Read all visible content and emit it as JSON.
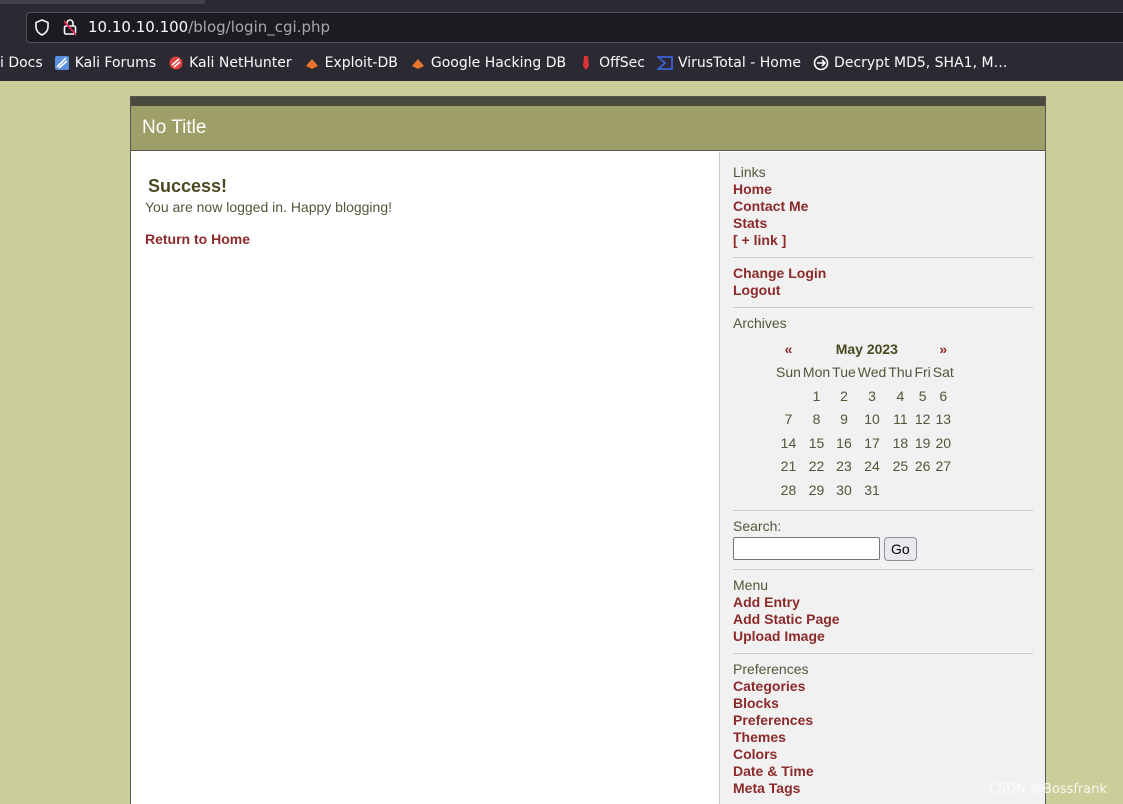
{
  "browser": {
    "url_host": "10.10.10.100",
    "url_path": "/blog/login_cgi.php",
    "bookmarks": [
      {
        "label": "i Docs",
        "icon": "none"
      },
      {
        "label": "Kali Forums",
        "icon": "kali-dragon-icon",
        "color": "#5a8fe0"
      },
      {
        "label": "Kali NetHunter",
        "icon": "nethunter-icon",
        "color": "#e0413f"
      },
      {
        "label": "Exploit-DB",
        "icon": "exploit-db-icon",
        "color": "#e8742a"
      },
      {
        "label": "Google Hacking DB",
        "icon": "ghdb-icon",
        "color": "#e8742a"
      },
      {
        "label": "OffSec",
        "icon": "offsec-icon",
        "color": "#d8323a"
      },
      {
        "label": "VirusTotal - Home",
        "icon": "virustotal-icon",
        "color": "#3b61d6"
      },
      {
        "label": "Decrypt MD5, SHA1, M…",
        "icon": "decrypt-icon",
        "color": "#ffffff"
      }
    ]
  },
  "site": {
    "title": "No Title"
  },
  "main": {
    "heading": "Success!",
    "message": "You are now logged in. Happy blogging!",
    "return_link": "Return to Home"
  },
  "sidebar": {
    "links_heading": "Links",
    "links": [
      "Home",
      "Contact Me",
      "Stats",
      "[ + link ]"
    ],
    "account_links": [
      "Change Login",
      "Logout"
    ],
    "archives_heading": "Archives",
    "calendar": {
      "prev": "«",
      "month": "May 2023",
      "next": "»",
      "weekdays": [
        "Sun",
        "Mon",
        "Tue",
        "Wed",
        "Thu",
        "Fri",
        "Sat"
      ],
      "weeks": [
        [
          "",
          "1",
          "2",
          "3",
          "4",
          "5",
          "6"
        ],
        [
          "7",
          "8",
          "9",
          "10",
          "11",
          "12",
          "13"
        ],
        [
          "14",
          "15",
          "16",
          "17",
          "18",
          "19",
          "20"
        ],
        [
          "21",
          "22",
          "23",
          "24",
          "25",
          "26",
          "27"
        ],
        [
          "28",
          "29",
          "30",
          "31",
          "",
          "",
          ""
        ]
      ]
    },
    "search_label": "Search:",
    "search_value": "",
    "search_button": "Go",
    "menu_heading": "Menu",
    "menu_links": [
      "Add Entry",
      "Add Static Page",
      "Upload Image"
    ],
    "prefs_heading": "Preferences",
    "prefs_links": [
      "Categories",
      "Blocks",
      "Preferences",
      "Themes",
      "Colors",
      "Date & Time",
      "Meta Tags"
    ]
  },
  "watermark": "CSDN @Bossfrank"
}
